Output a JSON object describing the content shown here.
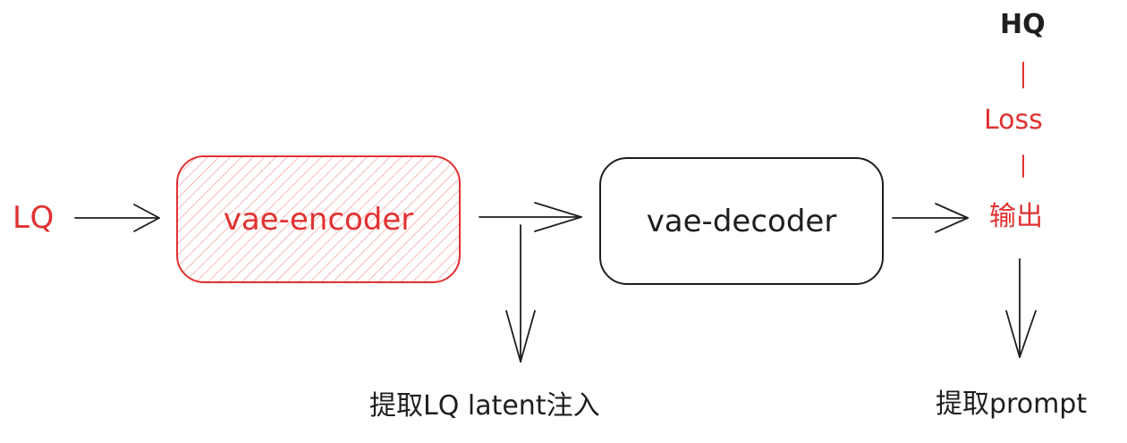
{
  "labels": {
    "lq": "LQ",
    "encoder": "vae-encoder",
    "decoder": "vae-decoder",
    "output": "输出",
    "loss": "Loss",
    "hq": "HQ",
    "extract_latent": "提取LQ latent注入",
    "extract_prompt": "提取prompt"
  },
  "colors": {
    "accent": "#e03131",
    "stroke": "#1e1e1e",
    "hatch": "#f2a7a7"
  }
}
